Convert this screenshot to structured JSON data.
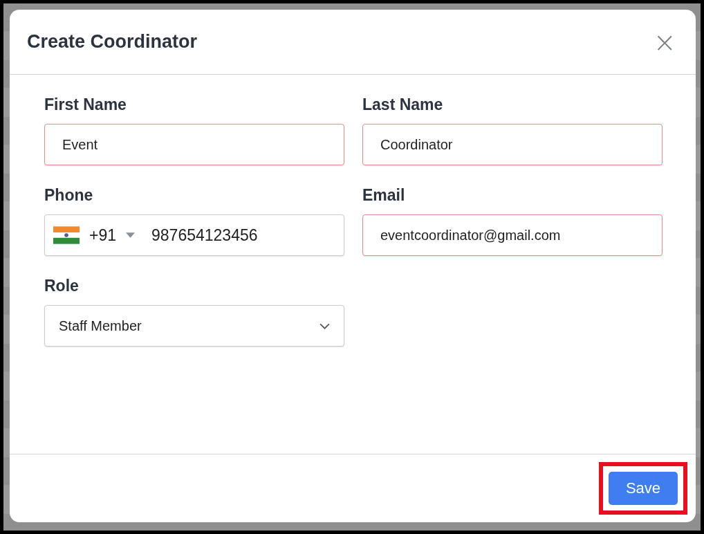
{
  "dialog": {
    "title": "Create Coordinator",
    "close_label": "×"
  },
  "fields": [
    {
      "kind": "text",
      "label": "First Name",
      "value": "Event",
      "invalid": true
    },
    {
      "kind": "text",
      "label": "Last Name",
      "value": "Coordinator",
      "invalid": true
    },
    {
      "kind": "phone",
      "label": "Phone",
      "dial_code": "+91",
      "value": "987654123456",
      "invalid": false
    },
    {
      "kind": "text",
      "label": "Email",
      "value": "eventcoordinator@gmail.com",
      "invalid": true
    },
    {
      "kind": "select",
      "label": "Role",
      "value": "Staff Member",
      "invalid": false
    }
  ],
  "footer": {
    "save_label": "Save",
    "save_highlighted": true
  }
}
